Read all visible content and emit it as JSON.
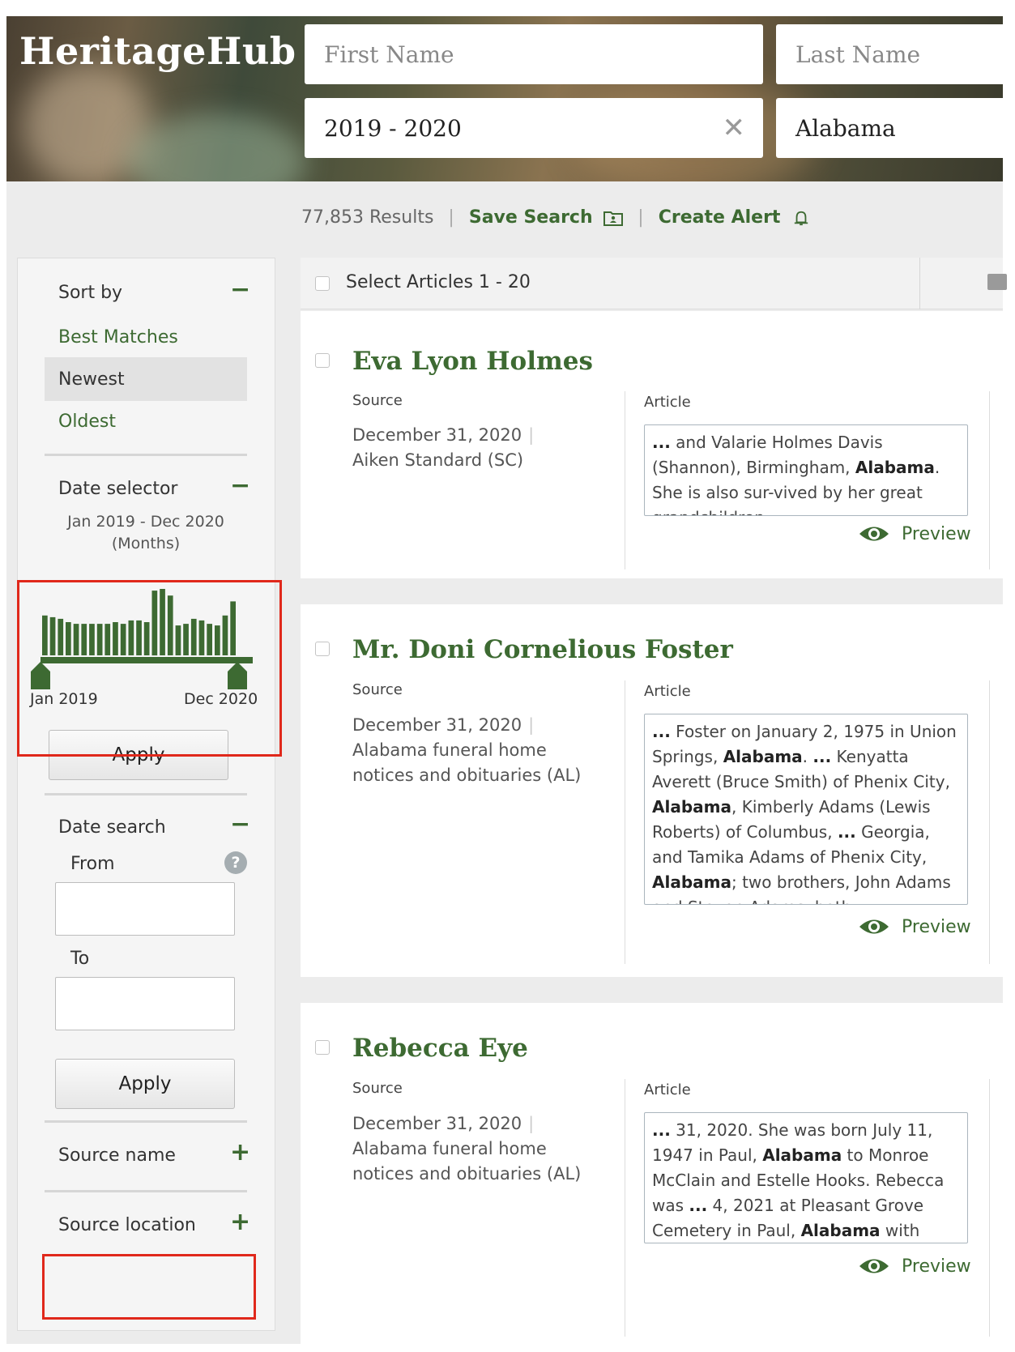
{
  "header": {
    "logo": "HeritageHub",
    "first_name_placeholder": "First Name",
    "last_name_placeholder": "Last Name",
    "date_value": "2019 - 2020",
    "location_value": "Alabama",
    "clear_glyph": "✕"
  },
  "results_bar": {
    "count": "77,853 Results",
    "save_search": "Save Search",
    "create_alert": "Create Alert",
    "separator": "|"
  },
  "sidebar": {
    "sort": {
      "heading": "Sort by",
      "toggle": "−",
      "options": [
        "Best Matches",
        "Newest",
        "Oldest"
      ],
      "selected": "Newest"
    },
    "date_selector": {
      "heading": "Date selector",
      "toggle": "−",
      "range_text": "Jan 2019 - Dec 2020",
      "unit_text": "(Months)",
      "start_label": "Jan 2019",
      "end_label": "Dec 2020",
      "monthly_counts": [
        48,
        46,
        44,
        40,
        38,
        38,
        38,
        38,
        38,
        40,
        38,
        42,
        42,
        40,
        78,
        80,
        72,
        36,
        38,
        44,
        42,
        38,
        36,
        48,
        65
      ],
      "apply_label": "Apply"
    },
    "date_search": {
      "heading": "Date search",
      "toggle": "−",
      "from_label": "From",
      "to_label": "To",
      "help_glyph": "?",
      "from_value": "",
      "to_value": "",
      "apply_label": "Apply"
    },
    "source_name": {
      "heading": "Source name",
      "toggle": "+"
    },
    "source_location": {
      "heading": "Source location",
      "toggle": "+"
    }
  },
  "results": {
    "select_label": "Select Articles 1 - 20",
    "source_label": "Source",
    "article_label": "Article",
    "preview_label": "Preview",
    "items": [
      {
        "name": "Eva Lyon Holmes",
        "date": "December 31, 2020",
        "source_name": "Aiken Standard (SC)",
        "excerpt_html": "<b>...</b> and Valarie Holmes Davis (Shannon), Birmingham, <b>Alabama</b>. She is also sur-vived by her great grandchildren <b>...</b>"
      },
      {
        "name": "Mr. Doni Cornelious Foster",
        "date": "December 31, 2020",
        "source_name": "Alabama funeral home notices and obituaries (AL)",
        "excerpt_html": "<b>...</b> Foster on January 2, 1975 in Union Springs, <b>Alabama</b>. <b>...</b> Kenyatta Averett (Bruce Smith) of Phenix City, <b>Alabama</b>, Kimberly Adams (Lewis Roberts) of Columbus, <b>...</b> Georgia, and Tamika Adams of Phenix City, <b>Alabama</b>; two brothers, John Adams and Steven Adams, both"
      },
      {
        "name": "Rebecca Eye",
        "date": "December 31, 2020",
        "source_name": "Alabama funeral home notices and obituaries (AL)",
        "excerpt_html": "<b>...</b> 31, 2020. She was born July 11, 1947 in Paul, <b>Alabama</b> to Monroe McClain and Estelle Hooks. Rebecca was <b>...</b> 4, 2021 at Pleasant Grove Cemetery in Paul, <b>Alabama</b> with John Lovelady <b>...</b>"
      }
    ]
  },
  "colors": {
    "accent_green": "#3d6a32",
    "highlight_red": "#e0281b",
    "histogram_green": "#3d6a32"
  }
}
